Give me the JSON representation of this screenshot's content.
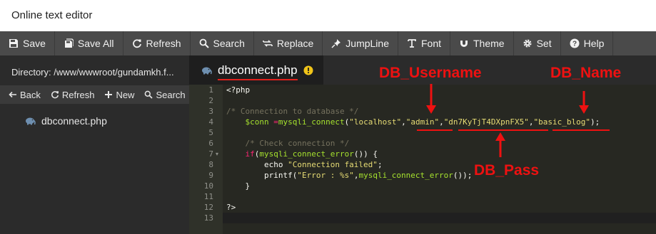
{
  "window": {
    "title": "Online text editor"
  },
  "toolbar": {
    "items": [
      {
        "label": "Save",
        "icon": "save-icon"
      },
      {
        "label": "Save All",
        "icon": "save-all-icon"
      },
      {
        "label": "Refresh",
        "icon": "refresh-icon"
      },
      {
        "label": "Search",
        "icon": "search-icon"
      },
      {
        "label": "Replace",
        "icon": "replace-icon"
      },
      {
        "label": "JumpLine",
        "icon": "pin-icon"
      },
      {
        "label": "Font",
        "icon": "font-icon"
      },
      {
        "label": "Theme",
        "icon": "magnet-icon"
      },
      {
        "label": "Set",
        "icon": "gear-icon"
      },
      {
        "label": "Help",
        "icon": "help-icon"
      }
    ]
  },
  "sidebar": {
    "directory": "Directory: /www/wwwroot/gundamkh.f...",
    "actions": [
      {
        "label": "Back",
        "icon": "back-arrow-icon"
      },
      {
        "label": "Refresh",
        "icon": "refresh-icon"
      },
      {
        "label": "New",
        "icon": "plus-icon"
      },
      {
        "label": "Search",
        "icon": "search-icon"
      }
    ],
    "files": [
      {
        "name": "dbconnect.php",
        "icon": "elephant-icon"
      }
    ]
  },
  "tab": {
    "label": "dbconnect.php",
    "status_icon": "warning-icon"
  },
  "editor": {
    "line_numbers": [
      "1",
      "2",
      "3",
      "4",
      "5",
      "6",
      "7",
      "8",
      "9",
      "10",
      "11",
      "12",
      "13"
    ],
    "fold_lines": [
      6
    ],
    "lines": [
      [
        {
          "t": "<?php",
          "c": ""
        }
      ],
      [],
      [
        {
          "t": "/* Connection to database */",
          "c": "c-comment"
        }
      ],
      [
        {
          "t": "    ",
          "c": ""
        },
        {
          "t": "$conn",
          "c": "c-var"
        },
        {
          "t": " ",
          "c": ""
        },
        {
          "t": "=",
          "c": "c-op"
        },
        {
          "t": "mysqli_connect",
          "c": "c-fn"
        },
        {
          "t": "(",
          "c": ""
        },
        {
          "t": "\"localhost\"",
          "c": "c-str"
        },
        {
          "t": ",",
          "c": ""
        },
        {
          "t": "\"admin\"",
          "c": "c-str"
        },
        {
          "t": ",",
          "c": ""
        },
        {
          "t": "\"dn7KyTjT4DXpnFX5\"",
          "c": "c-str"
        },
        {
          "t": ",",
          "c": ""
        },
        {
          "t": "\"basic_blog\"",
          "c": "c-str"
        },
        {
          "t": ");",
          "c": ""
        }
      ],
      [],
      [
        {
          "t": "    ",
          "c": ""
        },
        {
          "t": "/* Check connection */",
          "c": "c-comment"
        }
      ],
      [
        {
          "t": "    ",
          "c": ""
        },
        {
          "t": "if",
          "c": "c-op"
        },
        {
          "t": "(",
          "c": ""
        },
        {
          "t": "mysqli_connect_error",
          "c": "c-fn"
        },
        {
          "t": "()) {",
          "c": ""
        }
      ],
      [
        {
          "t": "        echo ",
          "c": ""
        },
        {
          "t": "\"Connection failed\"",
          "c": "c-str"
        },
        {
          "t": ";",
          "c": ""
        }
      ],
      [
        {
          "t": "        printf(",
          "c": ""
        },
        {
          "t": "\"Error : %s\"",
          "c": "c-str"
        },
        {
          "t": ",",
          "c": ""
        },
        {
          "t": "mysqli_connect_error",
          "c": "c-fn"
        },
        {
          "t": "());",
          "c": ""
        }
      ],
      [
        {
          "t": "    }",
          "c": ""
        }
      ],
      [],
      [
        {
          "t": "?>",
          "c": ""
        }
      ],
      []
    ]
  },
  "annotations": {
    "db_username": "DB_Username",
    "db_name": "DB_Name",
    "db_pass": "DB_Pass"
  },
  "colors": {
    "annotation_red": "#ee1111",
    "toolbar_bg": "#4a4a4a",
    "sidebar_bg": "#2b2b2b",
    "editor_bg": "#272822",
    "warning_yellow": "#f0c419"
  }
}
